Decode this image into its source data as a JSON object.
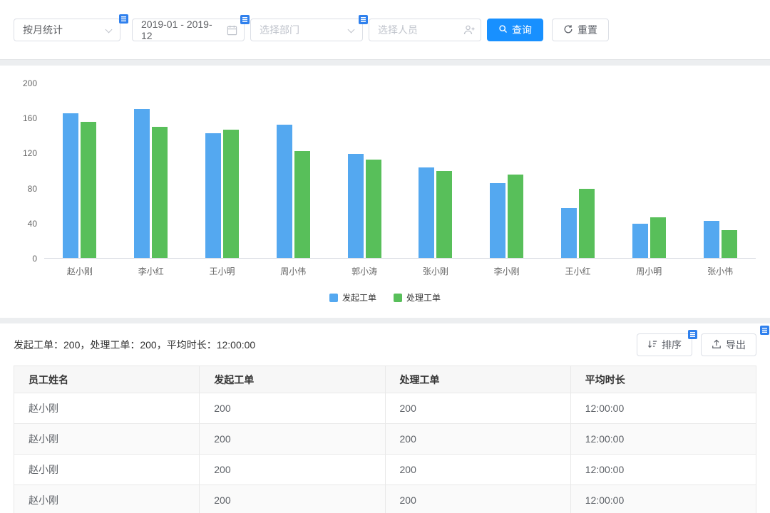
{
  "filters": {
    "stat_type": {
      "value": "按月统计"
    },
    "date_range": {
      "value": "2019-01 - 2019-12"
    },
    "department": {
      "placeholder": "选择部门"
    },
    "person": {
      "placeholder": "选择人员"
    },
    "query_label": "查询",
    "reset_label": "重置"
  },
  "icons": {
    "stat_chevron": "chevron-down",
    "date": "calendar",
    "department_chevron": "chevron-down",
    "person": "user-plus",
    "query": "magnifier",
    "reset": "refresh",
    "sort": "sort-descending",
    "export": "upload",
    "badge": "menu-badge"
  },
  "colors": {
    "accent": "#1890ff",
    "bar_blue": "#54a8f0",
    "bar_green": "#58bf5a",
    "badge_blue": "#2f80ed"
  },
  "chart_data": {
    "type": "bar",
    "categories": [
      "赵小刚",
      "李小红",
      "王小明",
      "周小伟",
      "郭小涛",
      "张小刚",
      "李小刚",
      "王小红",
      "周小明",
      "张小伟"
    ],
    "series": [
      {
        "name": "发起工单",
        "color": "#54a8f0",
        "values": [
          165,
          170,
          142,
          152,
          119,
          103,
          85,
          57,
          39,
          42
        ]
      },
      {
        "name": "处理工单",
        "color": "#58bf5a",
        "values": [
          155,
          150,
          146,
          122,
          112,
          99,
          95,
          79,
          46,
          32
        ]
      }
    ],
    "title": "",
    "xlabel": "",
    "ylabel": "",
    "ylim": [
      0,
      200
    ],
    "yticks": [
      0,
      40,
      80,
      120,
      160,
      200
    ],
    "grid": false,
    "legend_position": "bottom"
  },
  "summary": {
    "text": "发起工单：200，处理工单：200，平均时长：12:00:00"
  },
  "toolbar": {
    "sort_label": "排序",
    "export_label": "导出"
  },
  "table": {
    "headers": [
      "员工姓名",
      "发起工单",
      "处理工单",
      "平均时长"
    ],
    "rows": [
      [
        "赵小刚",
        "200",
        "200",
        "12:00:00"
      ],
      [
        "赵小刚",
        "200",
        "200",
        "12:00:00"
      ],
      [
        "赵小刚",
        "200",
        "200",
        "12:00:00"
      ],
      [
        "赵小刚",
        "200",
        "200",
        "12:00:00"
      ]
    ]
  }
}
